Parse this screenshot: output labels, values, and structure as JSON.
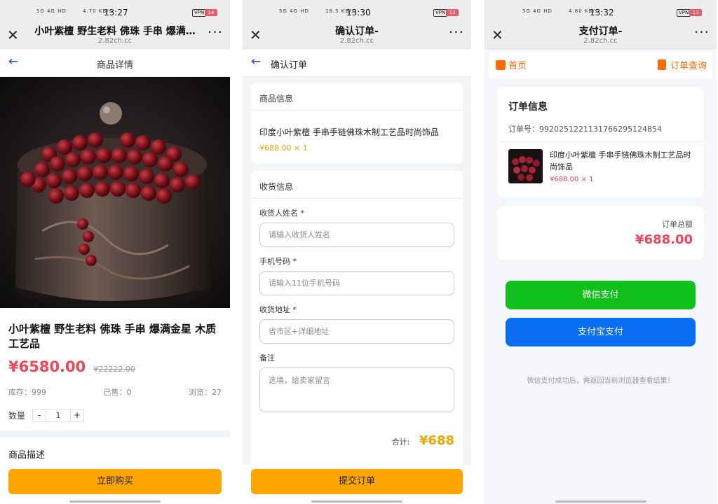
{
  "screens": [
    {
      "status": {
        "time": "13:27",
        "signal": "5G 4G HD",
        "speed": "4.70 KB/s",
        "vpn": "VPN",
        "battery": "14"
      },
      "wechat": {
        "title": "小叶紫檀 野生老料 佛珠 手串 爆满…",
        "domain": "2.82ch.cc"
      },
      "page_title": "商品详情",
      "product": {
        "name": "小叶紫檀 野生老料 佛珠 手串 爆满金星 木质工艺品",
        "price": "¥6580.00",
        "original_price": "¥22222.00",
        "stock": "库存：999",
        "sold": "已售：0",
        "views": "浏览：27",
        "qty_label": "数量",
        "qty_minus": "-",
        "qty_value": "1",
        "qty_plus": "+"
      },
      "desc_title": "商品描述",
      "buy_button": "立即购买"
    },
    {
      "status": {
        "time": "13:30",
        "signal": "5G 4G HD",
        "speed": "18.5 KB/s",
        "vpn": "VPN",
        "battery": "13"
      },
      "wechat": {
        "title": "确认订单-",
        "domain": "2.82ch.cc"
      },
      "page_title": "确认订单",
      "goods_section": "商品信息",
      "goods_name": "印度小叶紫檀 手串手链佛珠木制工艺品时尚饰品",
      "goods_price": "¥688.00 × 1",
      "ship_section": "收货信息",
      "fields": [
        {
          "label": "收货人姓名 *",
          "placeholder": "请输入收货人姓名"
        },
        {
          "label": "手机号码 *",
          "placeholder": "请输入11位手机号码"
        },
        {
          "label": "收货地址 *",
          "placeholder": "省市区+详细地址"
        },
        {
          "label": "备注",
          "placeholder": "选填，给卖家留言"
        }
      ],
      "total_label": "合计:",
      "total_value": "¥688",
      "submit_button": "提交订单"
    },
    {
      "status": {
        "time": "13:32",
        "signal": "5G 4G HD",
        "speed": "4.80 KB/s",
        "vpn": "VPN",
        "battery": "13"
      },
      "wechat": {
        "title": "支付订单-",
        "domain": "2.82ch.cc"
      },
      "home_link": "首页",
      "query_link": "订单查询",
      "order_info_title": "订单信息",
      "order_no": "订单号：992025122113176629512485​4",
      "goods_name": "印度小叶紫檀 手串手链佛珠木制工艺品时尚饰品",
      "goods_price": "¥688.00 × 1",
      "total_label": "订单总额",
      "total_value": "¥688.00",
      "wechat_pay": "微信支付",
      "alipay": "支付宝支付",
      "note": "微信支付成功后，需返回当前浏览器查看结果！"
    }
  ],
  "colors": {
    "price_red": "#f0465c",
    "orange": "#ffa500",
    "wechat_green": "#11c11b",
    "alipay_blue": "#0a6ef5",
    "nav_blue": "#1e3cc8"
  }
}
